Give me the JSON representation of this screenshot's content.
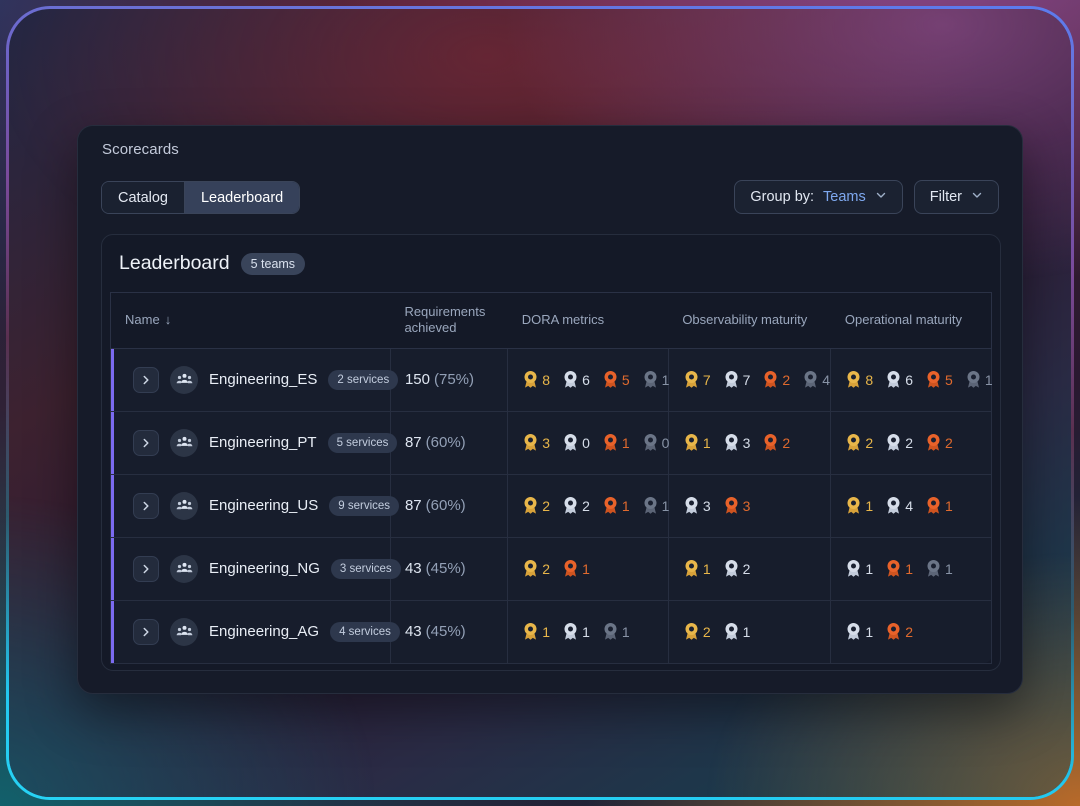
{
  "header": {
    "page_title": "Scorecards",
    "tabs": [
      {
        "label": "Catalog",
        "active": false
      },
      {
        "label": "Leaderboard",
        "active": true
      }
    ],
    "group_by": {
      "prefix": "Group by:",
      "value": "Teams",
      "chevron": "chevron-down-icon"
    },
    "filter": {
      "label": "Filter",
      "chevron": "chevron-down-icon"
    }
  },
  "leaderboard": {
    "title": "Leaderboard",
    "count_badge": "5 teams",
    "columns": [
      {
        "key": "name",
        "label": "Name",
        "sort": "↓"
      },
      {
        "key": "requirements",
        "label": "Requirements achieved"
      },
      {
        "key": "dora",
        "label": "DORA metrics"
      },
      {
        "key": "observability",
        "label": "Observability maturity"
      },
      {
        "key": "operational",
        "label": "Operational maturity"
      }
    ],
    "rows": [
      {
        "expander": "chevron-right-icon",
        "avatar": "team-icon",
        "name": "Engineering_ES",
        "services": "2 services",
        "requirements_value": "150",
        "requirements_pct": "(75%)",
        "dora": [
          {
            "tier": "gold",
            "count": "8"
          },
          {
            "tier": "silver",
            "count": "6"
          },
          {
            "tier": "bronze",
            "count": "5"
          },
          {
            "tier": "gray",
            "count": "1"
          }
        ],
        "observability": [
          {
            "tier": "gold",
            "count": "7"
          },
          {
            "tier": "silver",
            "count": "7"
          },
          {
            "tier": "bronze",
            "count": "2"
          },
          {
            "tier": "gray",
            "count": "4"
          }
        ],
        "operational": [
          {
            "tier": "gold",
            "count": "8"
          },
          {
            "tier": "silver",
            "count": "6"
          },
          {
            "tier": "bronze",
            "count": "5"
          },
          {
            "tier": "gray",
            "count": "1"
          }
        ]
      },
      {
        "expander": "chevron-right-icon",
        "avatar": "team-icon",
        "name": "Engineering_PT",
        "services": "5 services",
        "requirements_value": "87",
        "requirements_pct": "(60%)",
        "dora": [
          {
            "tier": "gold",
            "count": "3"
          },
          {
            "tier": "silver",
            "count": "0"
          },
          {
            "tier": "bronze",
            "count": "1"
          },
          {
            "tier": "gray",
            "count": "0"
          }
        ],
        "observability": [
          {
            "tier": "gold",
            "count": "1"
          },
          {
            "tier": "silver",
            "count": "3"
          },
          {
            "tier": "bronze",
            "count": "2"
          }
        ],
        "operational": [
          {
            "tier": "gold",
            "count": "2"
          },
          {
            "tier": "silver",
            "count": "2"
          },
          {
            "tier": "bronze",
            "count": "2"
          }
        ]
      },
      {
        "expander": "chevron-right-icon",
        "avatar": "team-icon",
        "name": "Engineering_US",
        "services": "9 services",
        "requirements_value": "87",
        "requirements_pct": "(60%)",
        "dora": [
          {
            "tier": "gold",
            "count": "2"
          },
          {
            "tier": "silver",
            "count": "2"
          },
          {
            "tier": "bronze",
            "count": "1"
          },
          {
            "tier": "gray",
            "count": "1"
          }
        ],
        "observability": [
          {
            "tier": "silver",
            "count": "3"
          },
          {
            "tier": "bronze",
            "count": "3"
          }
        ],
        "operational": [
          {
            "tier": "gold",
            "count": "1"
          },
          {
            "tier": "silver",
            "count": "4"
          },
          {
            "tier": "bronze",
            "count": "1"
          }
        ]
      },
      {
        "expander": "chevron-right-icon",
        "avatar": "team-icon",
        "name": "Engineering_NG",
        "services": "3 services",
        "requirements_value": "43",
        "requirements_pct": "(45%)",
        "dora": [
          {
            "tier": "gold",
            "count": "2"
          },
          {
            "tier": "bronze",
            "count": "1"
          }
        ],
        "observability": [
          {
            "tier": "gold",
            "count": "1"
          },
          {
            "tier": "silver",
            "count": "2"
          }
        ],
        "operational": [
          {
            "tier": "silver",
            "count": "1"
          },
          {
            "tier": "bronze",
            "count": "1"
          },
          {
            "tier": "gray",
            "count": "1"
          }
        ]
      },
      {
        "expander": "chevron-right-icon",
        "avatar": "team-icon",
        "name": "Engineering_AG",
        "services": "4 services",
        "requirements_value": "43",
        "requirements_pct": "(45%)",
        "dora": [
          {
            "tier": "gold",
            "count": "1"
          },
          {
            "tier": "silver",
            "count": "1"
          },
          {
            "tier": "gray",
            "count": "1"
          }
        ],
        "observability": [
          {
            "tier": "gold",
            "count": "2"
          },
          {
            "tier": "silver",
            "count": "1"
          }
        ],
        "operational": [
          {
            "tier": "silver",
            "count": "1"
          },
          {
            "tier": "bronze",
            "count": "2"
          }
        ]
      }
    ]
  },
  "colors": {
    "gold": "#e8b64a",
    "silver": "#d6dde9",
    "bronze": "#e8622a",
    "gray": "#6b7587",
    "accent_purple": "#7c6bf0",
    "link_blue": "#7ea8ef",
    "panel_bg": "#161b29"
  }
}
